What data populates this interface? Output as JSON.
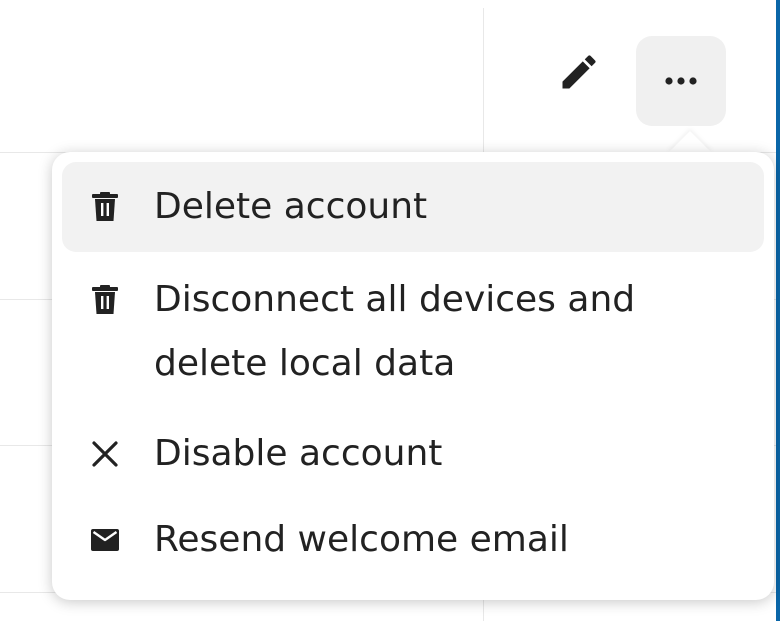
{
  "toolbar": {
    "edit_icon": "pencil-icon",
    "more_icon": "more-horizontal-icon"
  },
  "actions_menu": {
    "items": [
      {
        "label": "Delete account",
        "icon": "trash-icon"
      },
      {
        "label": "Disconnect all devices and delete local data",
        "icon": "trash-icon"
      },
      {
        "label": "Disable account",
        "icon": "close-icon"
      },
      {
        "label": "Resend welcome email",
        "icon": "email-icon"
      }
    ]
  },
  "colors": {
    "accent_bar": "#0a66a8",
    "menu_hover": "#f2f2f2",
    "button_bg": "#f0f0f0"
  }
}
